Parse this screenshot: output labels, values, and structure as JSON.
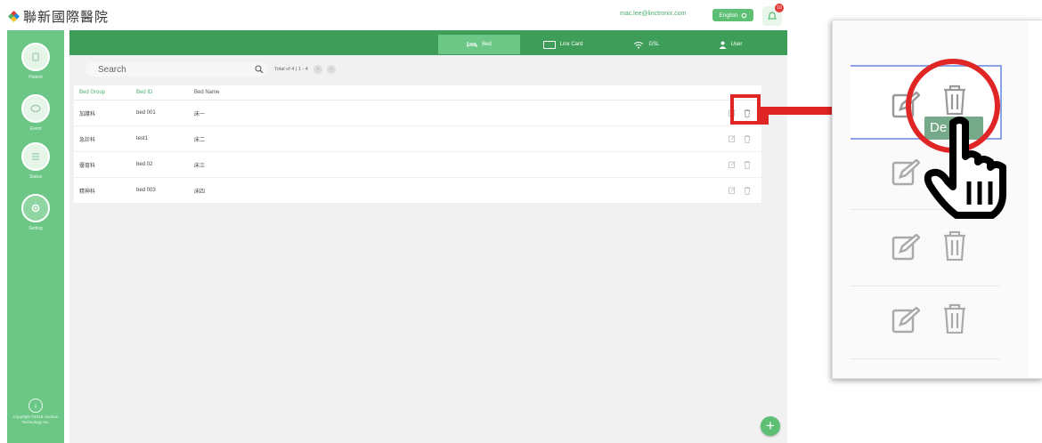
{
  "app": {
    "logo_text": "聯新國際醫院",
    "user_email": "mac.lee@linctronix.com",
    "language_label": "English",
    "notification_count": "10"
  },
  "sidebar": {
    "items": [
      {
        "label": "Patient",
        "icon": "bed-icon"
      },
      {
        "label": "Event",
        "icon": "chat-icon"
      },
      {
        "label": "Status",
        "icon": "list-icon"
      },
      {
        "label": "Setting",
        "icon": "gear-icon"
      }
    ],
    "active_index": 3,
    "copyright": "Copyright ©2018 Linctron Technology Inc."
  },
  "tabs": [
    {
      "label": "Bed",
      "icon": "bed-icon",
      "active": true
    },
    {
      "label": "Linx Card",
      "icon": "card-icon",
      "active": false
    },
    {
      "label": "GSL",
      "icon": "wifi-icon",
      "active": false
    },
    {
      "label": "User",
      "icon": "user-icon",
      "active": false
    }
  ],
  "search": {
    "placeholder": "Search",
    "total_text": "Total of 4 | 1 - 4"
  },
  "table": {
    "headers": [
      "Bed Group",
      "Bed ID",
      "Bed Name"
    ],
    "rows": [
      [
        "加護科",
        "bed 001",
        "床一"
      ],
      [
        "急診科",
        "test1",
        "床二"
      ],
      [
        "優育科",
        "bed 02",
        "床三"
      ],
      [
        "精神科",
        "bed 003",
        "床四"
      ]
    ]
  },
  "zoom_panel": {
    "tooltip_text": "De"
  },
  "colors": {
    "primary": "#3e9d59",
    "sidebar": "#6cc786",
    "highlight": "#e02525"
  }
}
